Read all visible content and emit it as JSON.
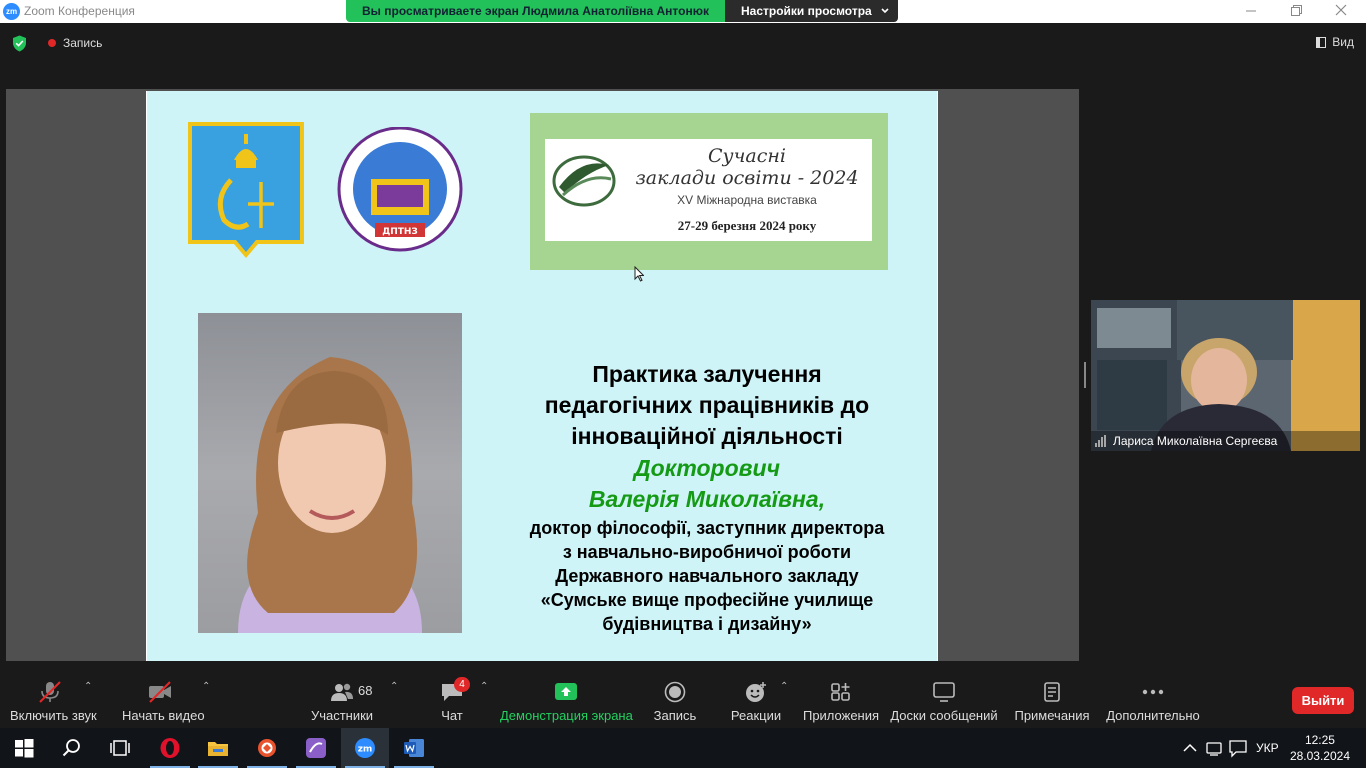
{
  "window": {
    "app_logo": "zm",
    "title": "Zoom Конференция"
  },
  "share_banner": {
    "viewing_text": "Вы просматриваете экран Людмила Анатоліївна Антонюк",
    "view_options": "Настройки просмотра"
  },
  "top_bar": {
    "record_label": "Запись",
    "view_label": "Вид"
  },
  "slide": {
    "expo_title_line1": "Сучасні",
    "expo_title_line2": "заклади освіти - 2024",
    "expo_subtitle": "XV Міжнародна виставка",
    "expo_dates": "27-29 березня 2024 року",
    "emblem_text": "ДПТНЗ",
    "title_line1": "Практика залучення",
    "title_line2": "педагогічних працівників до",
    "title_line3": "інноваційної діяльності",
    "author_line1": "Докторович",
    "author_line2": "Валерія Миколаївна,",
    "desc_line1": "доктор філософії, заступник директора",
    "desc_line2": "з навчально-виробничої роботи",
    "desc_line3": "Державного навчального закладу",
    "desc_line4": "«Сумське вище професійне училище",
    "desc_line5": "будівництва і дизайну»"
  },
  "participant_tile": {
    "name": "Лариса Миколаївна Сергеєва"
  },
  "toolbar": {
    "mute_label": "Включить звук",
    "video_label": "Начать видео",
    "participants_label": "Участники",
    "participants_count": "68",
    "chat_label": "Чат",
    "chat_badge": "4",
    "share_label": "Демонстрация экрана",
    "record_label": "Запись",
    "reactions_label": "Реакции",
    "apps_label": "Приложения",
    "whiteboards_label": "Доски сообщений",
    "notes_label": "Примечания",
    "more_label": "Дополнительно",
    "leave_label": "Выйти"
  },
  "taskbar": {
    "language": "УКР",
    "time": "12:25",
    "date": "28.03.2024"
  },
  "colors": {
    "share_green": "#23c15a",
    "slide_bg": "#cff4f8",
    "author_green": "#159a15",
    "leave_red": "#e02828"
  }
}
